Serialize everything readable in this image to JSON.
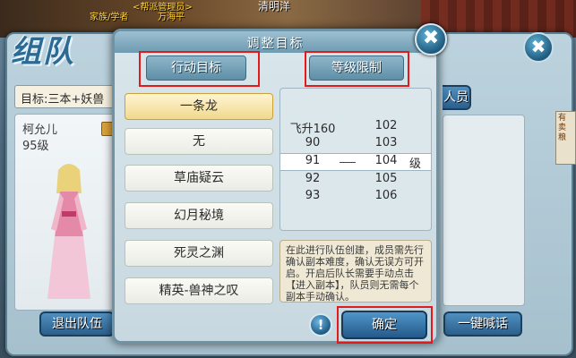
{
  "top_bar": {
    "player_left": "家族/学者",
    "player_center_line1": "<帮派管理员>",
    "player_center_line2": "万海平",
    "player_right": "清明洋"
  },
  "team_panel": {
    "logo_text": "组队",
    "target_label": "目标:三本+妖兽",
    "member": {
      "name": "柯允儿",
      "level": "95级"
    },
    "member_button_label": "人员",
    "leave_button": "退出队伍",
    "shout_button": "一键喊话",
    "side_text": "有卖粮"
  },
  "dialog": {
    "title": "调整目标",
    "tab_goal": "行动目标",
    "tab_level": "等级限制",
    "goals": [
      {
        "label": "一条龙",
        "selected": true
      },
      {
        "label": "无",
        "selected": false
      },
      {
        "label": "草庙疑云",
        "selected": false
      },
      {
        "label": "幻月秘境",
        "selected": false
      },
      {
        "label": "死灵之渊",
        "selected": false
      },
      {
        "label": "精英-兽神之叹",
        "selected": false
      }
    ],
    "levels": [
      {
        "left": "飞升160",
        "right": "102"
      },
      {
        "left": "90",
        "right": "103"
      },
      {
        "left": "91",
        "right": "104",
        "selected": true,
        "unit": "级"
      },
      {
        "left": "92",
        "right": "105"
      },
      {
        "left": "93",
        "right": "106"
      }
    ],
    "info_text": "在此进行队伍创建，成员需先行确认副本难度，确认无误方可开启。开启后队长需要手动点击【进入副本】，队员则无需每个副本手动确认。",
    "confirm_button": "确定",
    "info_icon": "!",
    "close_icon": "✖"
  },
  "colors": {
    "highlight_box": "#e11b1b",
    "button_blue": "#2c5f8c",
    "selected_goal": "#f0d98e"
  }
}
